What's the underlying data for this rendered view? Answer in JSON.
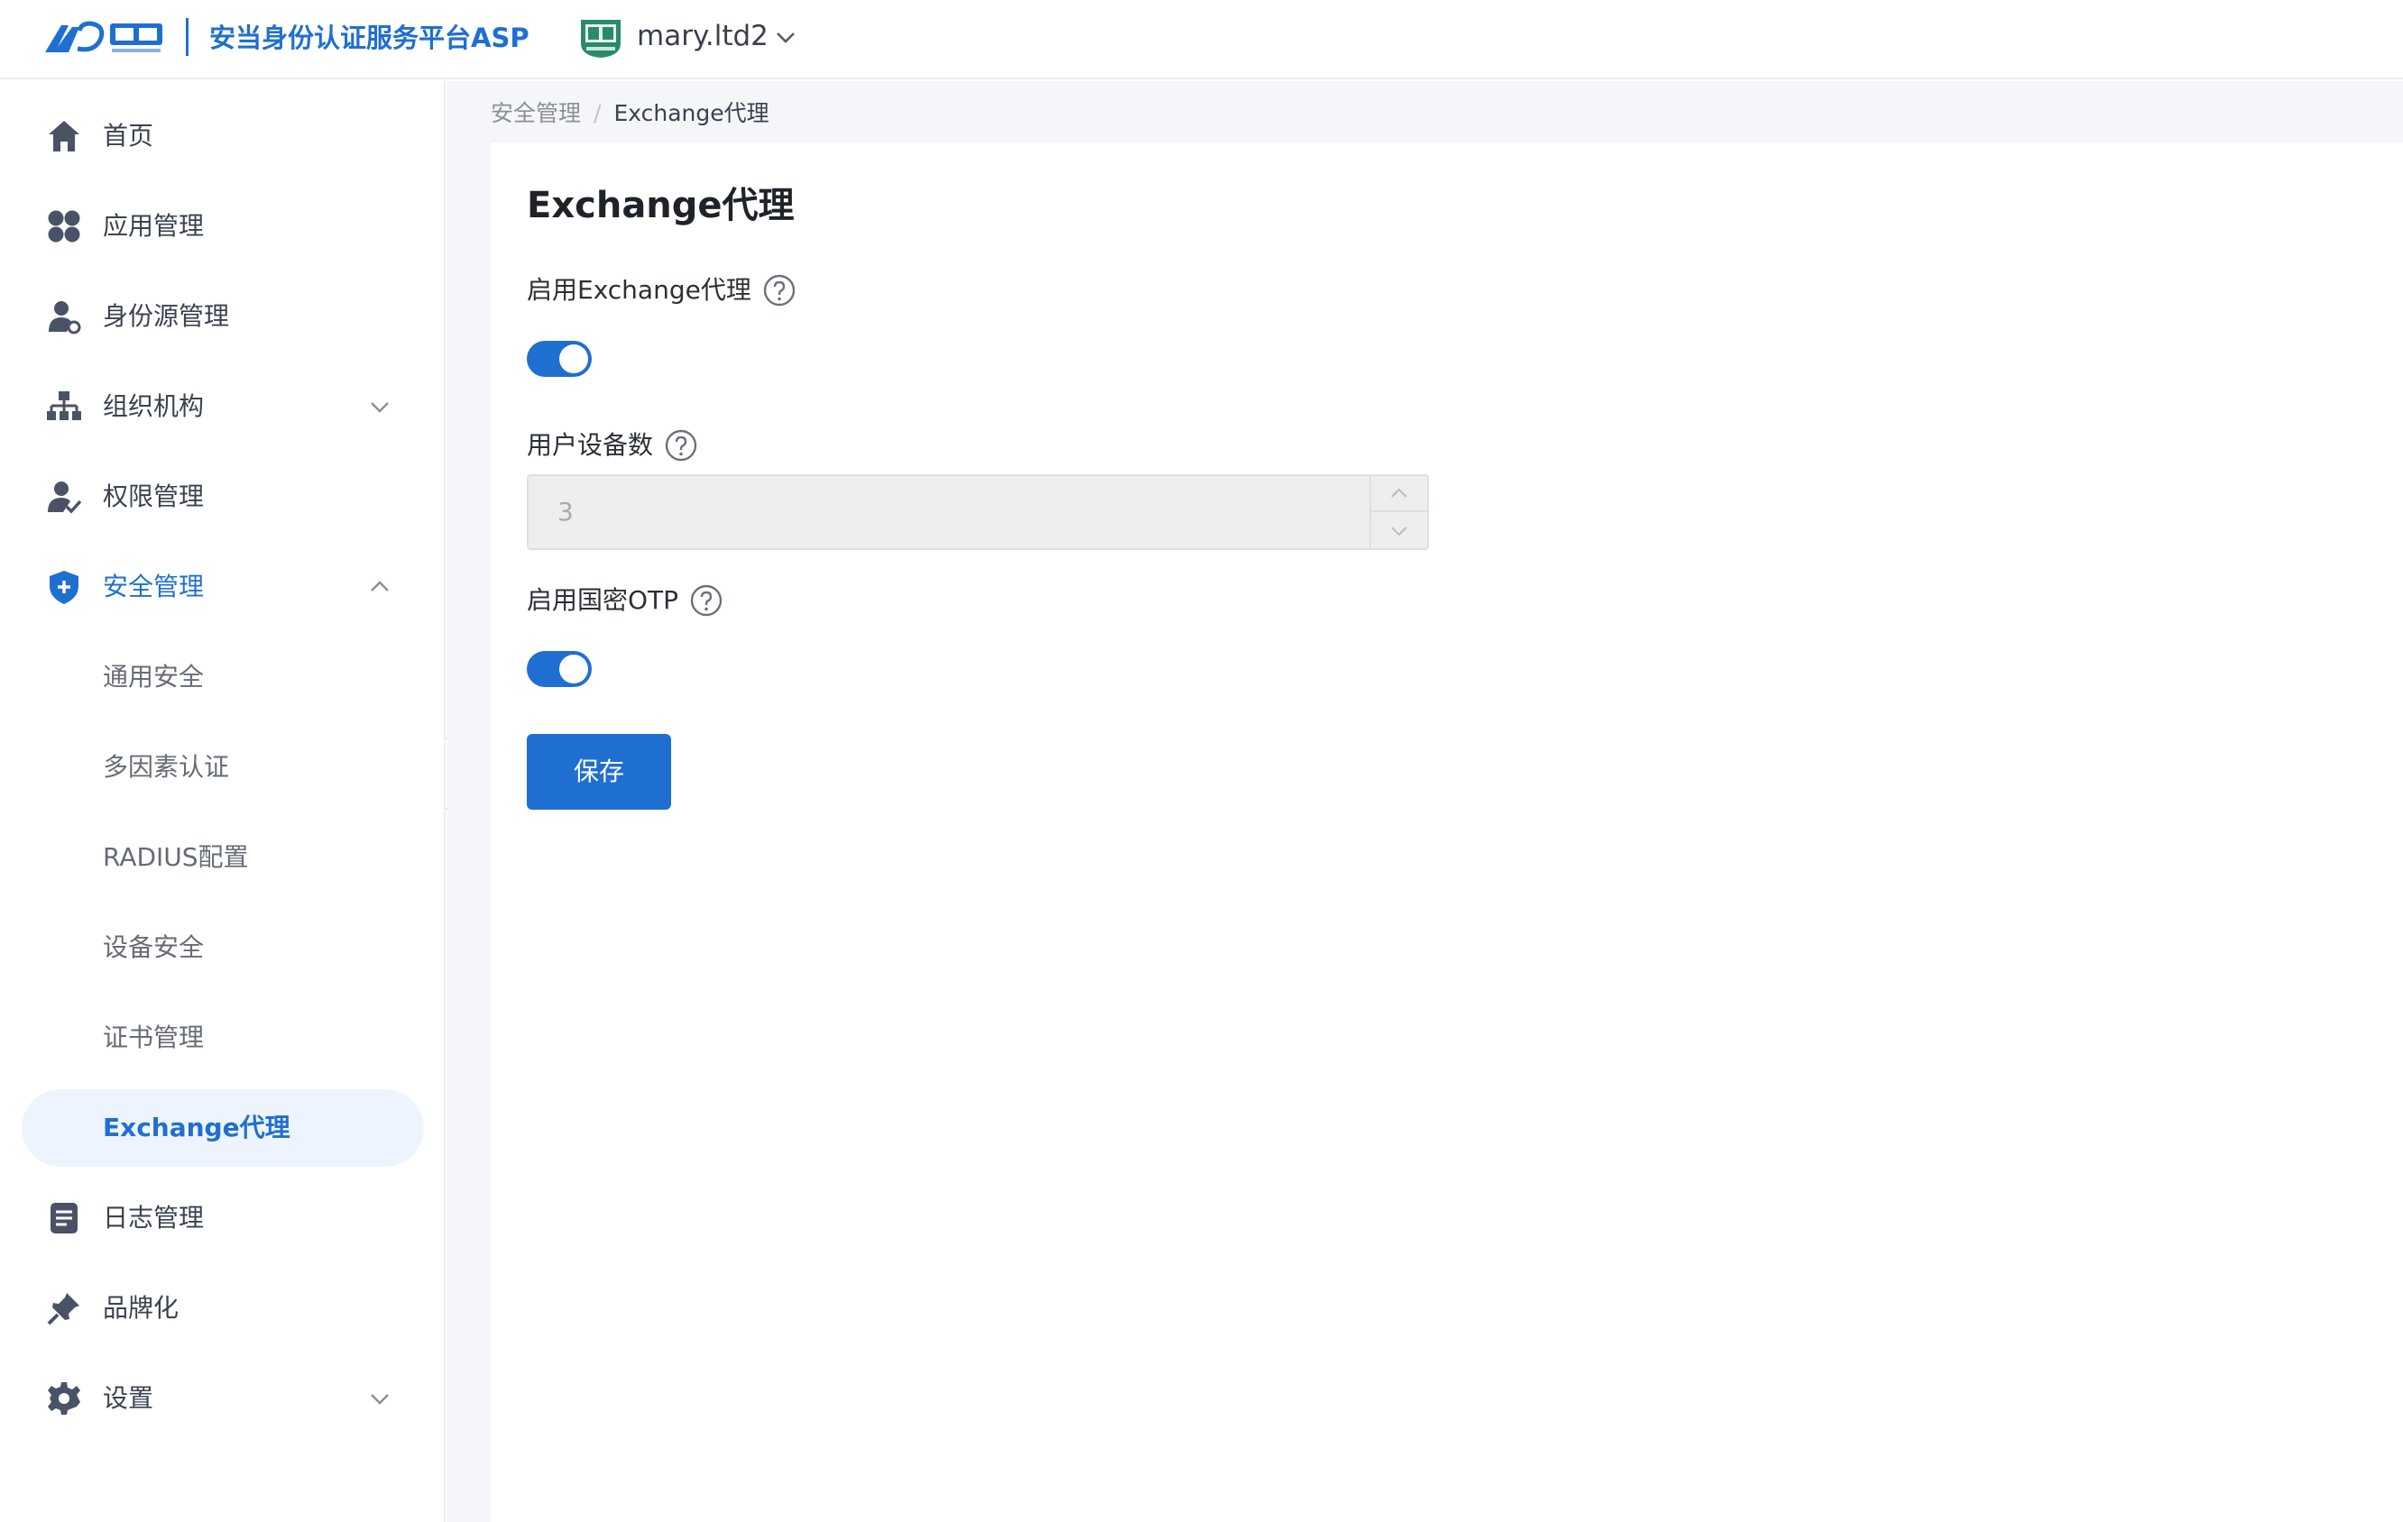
{
  "header": {
    "platform_name": "安当身份认证服务平台ASP",
    "tenant_name": "mary.ltd2",
    "brand_color": "#1f6fd1"
  },
  "sidebar": {
    "items": [
      {
        "label": "首页",
        "icon": "home-icon"
      },
      {
        "label": "应用管理",
        "icon": "apps-icon"
      },
      {
        "label": "身份源管理",
        "icon": "identity-source-icon"
      },
      {
        "label": "组织机构",
        "icon": "org-chart-icon",
        "expandable": true,
        "expanded": false
      },
      {
        "label": "权限管理",
        "icon": "user-permission-icon"
      },
      {
        "label": "安全管理",
        "icon": "shield-icon",
        "expandable": true,
        "expanded": true
      },
      {
        "label": "通用安全",
        "sub": true
      },
      {
        "label": "多因素认证",
        "sub": true
      },
      {
        "label": "RADIUS配置",
        "sub": true
      },
      {
        "label": "设备安全",
        "sub": true
      },
      {
        "label": "证书管理",
        "sub": true
      },
      {
        "label": "Exchange代理",
        "sub": true,
        "active": true
      },
      {
        "label": "日志管理",
        "icon": "log-icon"
      },
      {
        "label": "品牌化",
        "icon": "brand-pin-icon"
      },
      {
        "label": "设置",
        "icon": "gear-icon",
        "expandable": true,
        "expanded": false
      }
    ]
  },
  "breadcrumb": {
    "parent": "安全管理",
    "separator": "/",
    "current": "Exchange代理"
  },
  "form": {
    "title": "Exchange代理",
    "enable_exchange_label": "启用Exchange代理",
    "enable_exchange_on": true,
    "device_count_label": "用户设备数",
    "device_count_value": "3",
    "enable_otp_label": "启用国密OTP",
    "enable_otp_on": true,
    "save_label": "保存"
  }
}
